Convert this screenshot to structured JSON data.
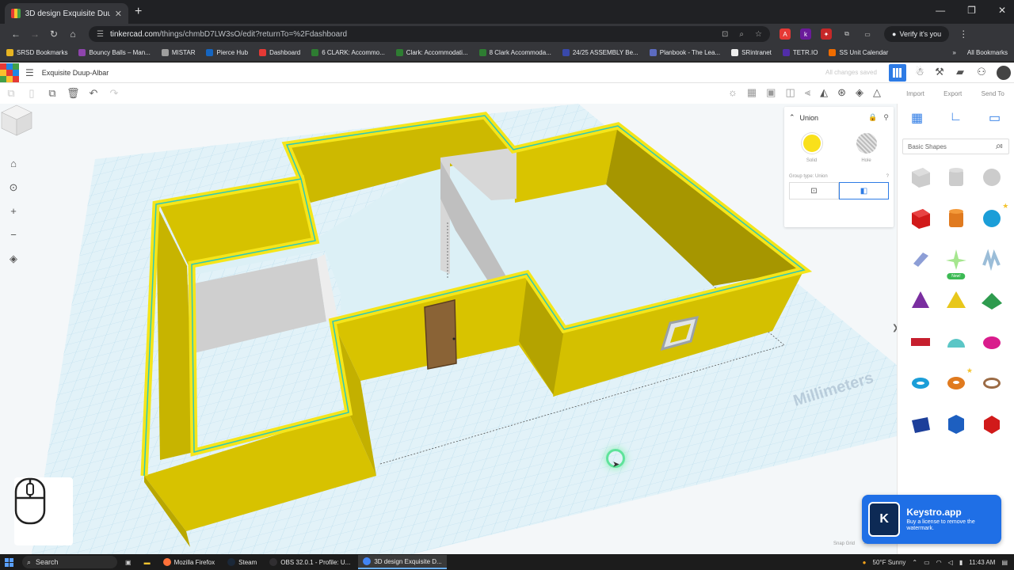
{
  "browser": {
    "tab_title": "3D design Exquisite Duup-Alba",
    "tab_close": "✕",
    "new_tab": "+",
    "window_controls": [
      "—",
      "❐",
      "✕"
    ],
    "url_host": "tinkercad.com",
    "url_path": "/things/chmbD7LW3sO/edit?returnTo=%2Fdashboard",
    "verify_label": "Verify it's you",
    "bookmarks": [
      {
        "label": "SRSD Bookmarks",
        "color": "#e6b422"
      },
      {
        "label": "Bouncy Balls – Man...",
        "color": "#8e44ad"
      },
      {
        "label": "MISTAR",
        "color": "#9e9e9e"
      },
      {
        "label": "Pierce Hub",
        "color": "#1565c0"
      },
      {
        "label": "Dashboard",
        "color": "#e53935"
      },
      {
        "label": "6 CLARK: Accommo...",
        "color": "#2e7d32"
      },
      {
        "label": "Clark: Accommodati...",
        "color": "#2e7d32"
      },
      {
        "label": "8 Clark Accommoda...",
        "color": "#2e7d32"
      },
      {
        "label": "24/25 ASSEMBLY Be...",
        "color": "#3949ab"
      },
      {
        "label": "Planbook - The Lea...",
        "color": "#5c6bc0"
      },
      {
        "label": "SRintranet",
        "color": "#eeeeee"
      },
      {
        "label": "TETR.IO",
        "color": "#512da8"
      },
      {
        "label": "SS Unit Calendar",
        "color": "#ef6c00"
      }
    ],
    "all_bookmarks": "All Bookmarks"
  },
  "tinkercad": {
    "design_name": "Exquisite Duup-Albar",
    "save_status": "All changes saved",
    "right_tabs": [
      "Import",
      "Export",
      "Send To"
    ],
    "inspector": {
      "title": "Union",
      "solid_label": "Solid",
      "hole_label": "Hole",
      "group_type_label": "Group type: Union",
      "solid_color": "#f9e01b"
    },
    "units_label": "Millimeters",
    "snap_grid_label": "Snap Grid",
    "snap_grid_value": "1.0 mm",
    "shapes_category": "Basic Shapes",
    "new_badge": "New!"
  },
  "keystro": {
    "letter": "K",
    "title": "Keystro.app",
    "subtitle": "Buy a license to remove the watermark."
  },
  "taskbar": {
    "search_placeholder": "Search",
    "apps": [
      {
        "label": "Mozilla Firefox",
        "color": "#ff7139"
      },
      {
        "label": "Steam",
        "color": "#1b2838"
      },
      {
        "label": "OBS 32.0.1 - Profile: U...",
        "color": "#302e31"
      },
      {
        "label": "3D design Exquisite D...",
        "color": "#4285f4"
      }
    ],
    "weather": "50°F  Sunny",
    "time": "11:43 AM"
  }
}
